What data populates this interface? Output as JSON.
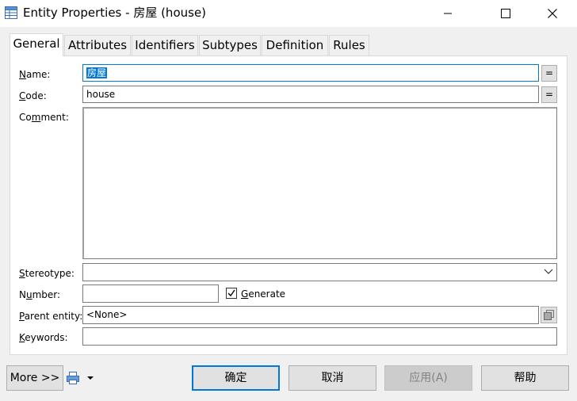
{
  "window": {
    "title": "Entity Properties - 房屋 (house)",
    "icons": {
      "app": "entity-table-icon",
      "minimize": "minimize-icon",
      "maximize": "maximize-icon",
      "close": "close-icon"
    }
  },
  "tabs": [
    {
      "label": "General",
      "active": true
    },
    {
      "label": "Attributes"
    },
    {
      "label": "Identifiers"
    },
    {
      "label": "Subtypes"
    },
    {
      "label": "Definition"
    },
    {
      "label": "Rules"
    }
  ],
  "form": {
    "name": {
      "label_pre": "",
      "label_u": "N",
      "label_post": "ame:",
      "value": "房屋",
      "button": "="
    },
    "code": {
      "label_pre": "",
      "label_u": "C",
      "label_post": "ode:",
      "value": "house",
      "button": "="
    },
    "comment": {
      "label_pre": "Co",
      "label_u": "m",
      "label_post": "ment:",
      "value": ""
    },
    "stereotype": {
      "label_pre": "",
      "label_u": "S",
      "label_post": "tereotype:",
      "value": ""
    },
    "number": {
      "label_pre": "N",
      "label_u": "u",
      "label_post": "mber:",
      "value": ""
    },
    "generate": {
      "label_pre": "",
      "label_u": "G",
      "label_post": "enerate",
      "checked": true
    },
    "parent_entity": {
      "label_pre": "",
      "label_u": "P",
      "label_post": "arent entity:",
      "value": "<None>"
    },
    "keywords": {
      "label_pre": "",
      "label_u": "K",
      "label_post": "eywords:",
      "value": ""
    }
  },
  "footer": {
    "more": "More >>",
    "ok": "确定",
    "cancel": "取消",
    "apply": "应用(A)",
    "help": "帮助"
  },
  "colors": {
    "accent": "#0078d7",
    "panel": "#ffffff",
    "background": "#f0f0f0"
  }
}
